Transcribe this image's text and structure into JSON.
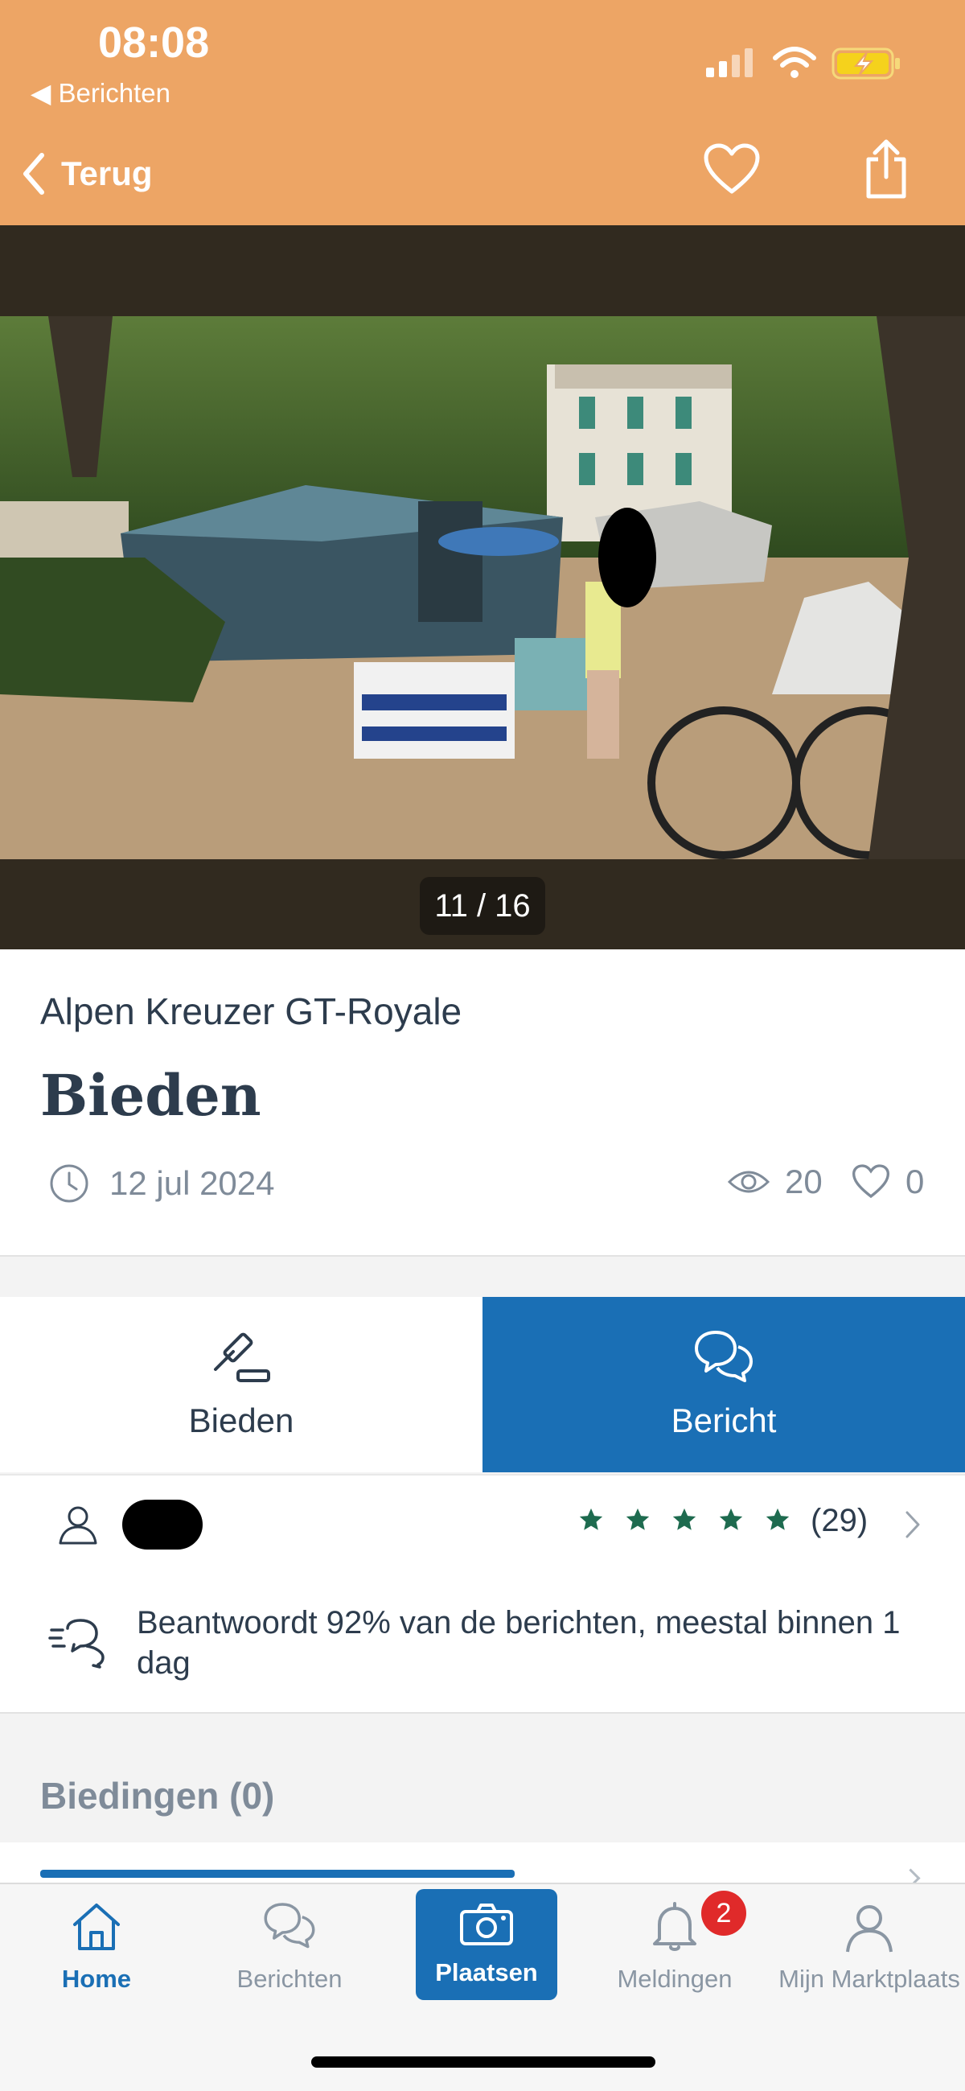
{
  "status_bar": {
    "time": "08:08",
    "back_app": "◀ Berichten"
  },
  "nav": {
    "back_label": "Terug"
  },
  "gallery": {
    "counter": "11 / 16"
  },
  "listing": {
    "title": "Alpen Kreuzer GT-Royale",
    "price": "Bieden",
    "date": "12 jul 2024",
    "views": "20",
    "favorites": "0"
  },
  "actions": {
    "bid_label": "Bieden",
    "message_label": "Bericht"
  },
  "seller": {
    "rating_count": "(29)",
    "stars": 5
  },
  "response": {
    "text": "Beantwoordt 92% van de berichten, meestal binnen 1 dag"
  },
  "bids": {
    "heading": "Biedingen (0)"
  },
  "tabbar": {
    "home": "Home",
    "messages": "Berichten",
    "place": "Plaatsen",
    "notifications": "Meldingen",
    "notifications_badge": "2",
    "account": "Mijn Marktplaats"
  },
  "colors": {
    "header": "#eda565",
    "accent": "#1a6fb5",
    "star": "#1e6b4f",
    "badge": "#e02a2a"
  }
}
